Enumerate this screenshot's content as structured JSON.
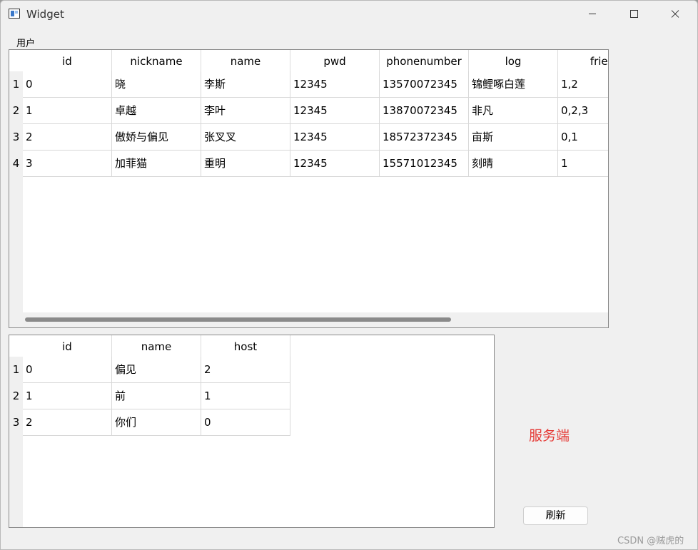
{
  "window": {
    "title": "Widget"
  },
  "users_label": "用户",
  "users_table": {
    "columns": [
      "id",
      "nickname",
      "name",
      "pwd",
      "phonenumber",
      "log",
      "frien"
    ],
    "row_numbers": [
      "1",
      "2",
      "3",
      "4"
    ],
    "rows": [
      [
        "0",
        "晓",
        "李斯",
        "12345",
        "13570072345",
        "锦鲤啄白莲",
        "1,2"
      ],
      [
        "1",
        "卓越",
        "李叶",
        "12345",
        "13870072345",
        "非凡",
        "0,2,3"
      ],
      [
        "2",
        "傲娇与偏见",
        "张叉叉",
        "12345",
        "18572372345",
        "亩斯",
        "0,1"
      ],
      [
        "3",
        "加菲猫",
        "重明",
        "12345",
        "15571012345",
        "刻晴",
        "1"
      ]
    ]
  },
  "rooms_table": {
    "columns": [
      "id",
      "name",
      "host"
    ],
    "row_numbers": [
      "1",
      "2",
      "3"
    ],
    "rows": [
      [
        "0",
        "偏见",
        "2"
      ],
      [
        "1",
        "前",
        "1"
      ],
      [
        "2",
        "你们",
        "0"
      ]
    ]
  },
  "server_label": "服务端",
  "refresh_label": "刷新",
  "watermark": "CSDN @贼虎的",
  "colors": {
    "server_label": "#e53935",
    "window_bg": "#f0f0f0"
  }
}
